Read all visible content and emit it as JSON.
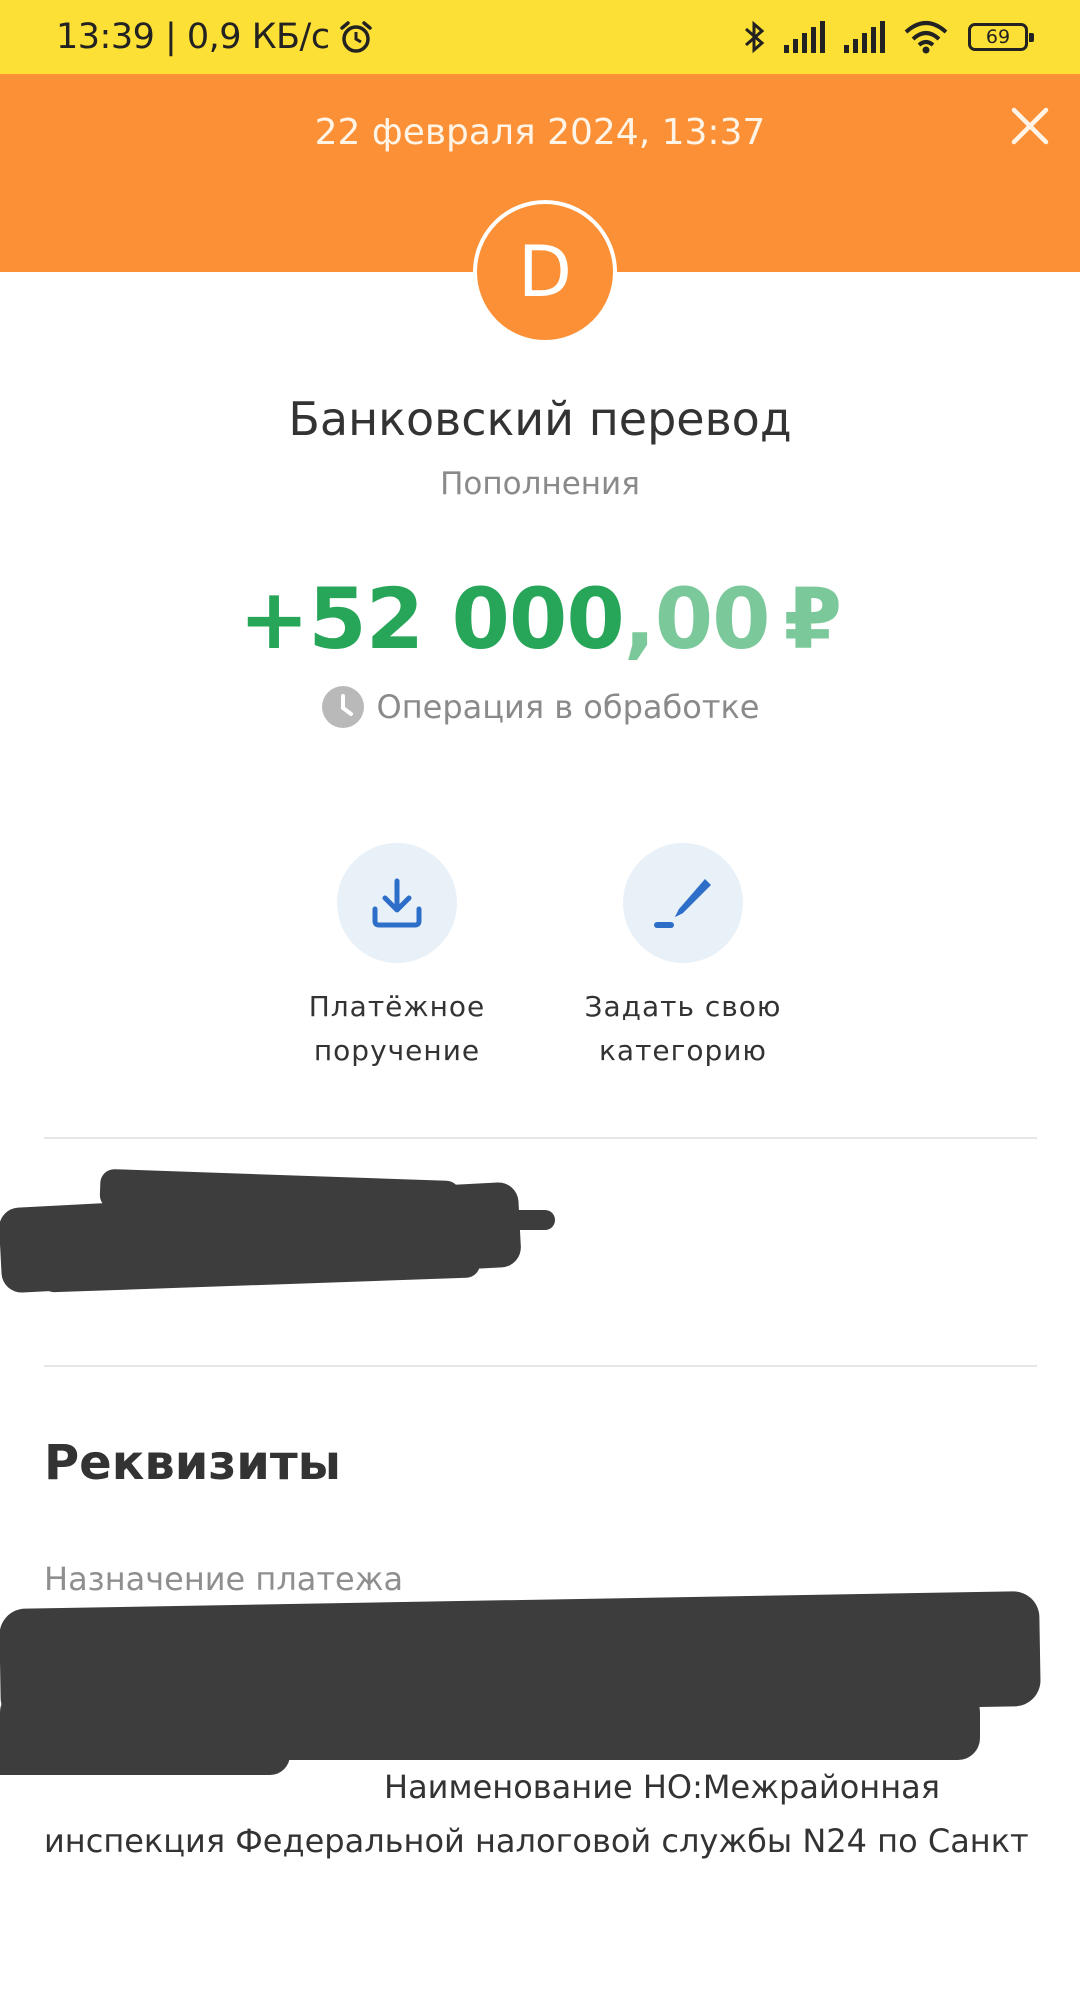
{
  "status_bar": {
    "time_speed": "13:39 | 0,9 КБ/с",
    "battery": "69"
  },
  "header": {
    "date": "22 февраля 2024, 13:37",
    "bg_color": "#fb9036"
  },
  "avatar": {
    "letter": "D"
  },
  "transaction": {
    "title": "Банковский перевод",
    "category": "Пополнения",
    "amount_main": "+52 000",
    "amount_frac": ",00",
    "currency": "₽",
    "status": "Операция в обработке",
    "amount_color": "#27a558"
  },
  "actions": [
    {
      "icon": "download-icon",
      "line1": "Платёжное",
      "line2": "поручение"
    },
    {
      "icon": "pencil-icon",
      "line1": "Задать свою",
      "line2": "категорию"
    }
  ],
  "details": {
    "section_title": "Реквизиты",
    "purpose_label": "Назначение платежа",
    "purpose_visible_line1": "Наименование НО:Межрайонная",
    "purpose_visible_line2": "инспекция Федеральной налоговой службы N24 по Санкт"
  }
}
